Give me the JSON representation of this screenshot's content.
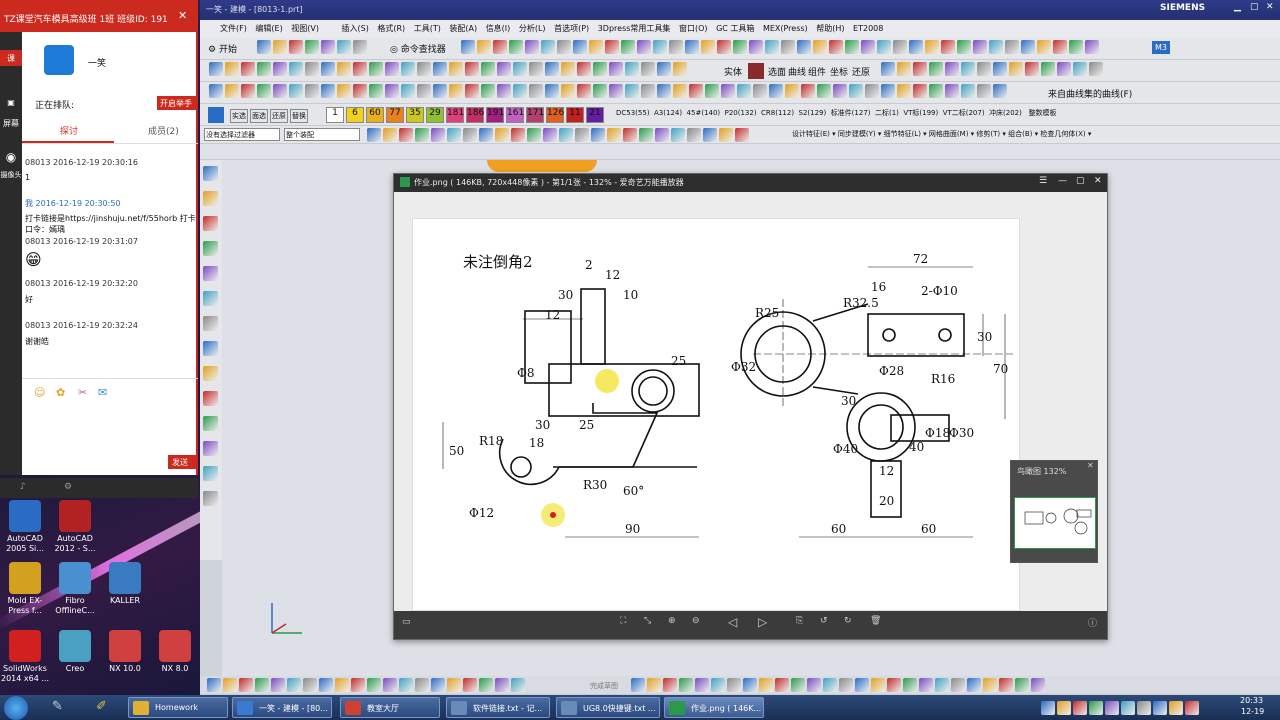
{
  "chat": {
    "title": "TZ课堂汽车模具高级班 1班  班级ID: 191",
    "tab_left": "课",
    "screen_label": "屏幕",
    "camera_label": "摄像头",
    "avatar_text": "一笑",
    "queue_label": "正在排队:",
    "raise_hand": "开启举手",
    "tabs": [
      "探讨",
      "成员(2)"
    ],
    "messages": [
      {
        "name": "08013 2016-12-19 20:30:16",
        "text": "1"
      },
      {
        "name": "我 2016-12-19 20:30:50",
        "text": "打卡链接是https://jinshuju.net/f/55horb  打卡口令：嫣瑀"
      },
      {
        "name": "08013 2016-12-19 20:31:07",
        "text": "😁"
      },
      {
        "name": "08013 2016-12-19 20:32:20",
        "text": "好"
      },
      {
        "name": "08013 2016-12-19 20:32:24",
        "text": "谢谢皓"
      }
    ],
    "send": "发送"
  },
  "desktop_icons": [
    {
      "label": "AutoCAD 2005 Si...",
      "color": "#2a6cc4"
    },
    {
      "label": "AutoCAD 2012 - S...",
      "color": "#b22222"
    },
    {
      "label": "Mold EX-Press f...",
      "color": "#d4a020"
    },
    {
      "label": "Fibro OfflineC...",
      "color": "#4a8fd0"
    },
    {
      "label": "KALLER",
      "color": "#3a7ac0"
    },
    {
      "label": "SolidWorks 2014 x64 ...",
      "color": "#d02020"
    },
    {
      "label": "Creo",
      "color": "#4aa0c0"
    },
    {
      "label": "NX 10.0",
      "color": "#d04040"
    },
    {
      "label": "NX 8.0",
      "color": "#d04040"
    }
  ],
  "nx": {
    "title": "一笑 - 建模 - [8013-1.prt]",
    "brand": "SIEMENS",
    "menu": [
      "文件(F)",
      "编辑(E)",
      "视图(V)",
      "插入(S)",
      "格式(R)",
      "工具(T)",
      "装配(A)",
      "信息(I)",
      "分析(L)",
      "首选项(P)",
      "3Dpress常用工具集",
      "窗口(O)",
      "GC 工具箱",
      "MEX(Press)",
      "帮助(H)",
      "ET2008"
    ],
    "start": "开始",
    "cmd_finder": "命令查找器",
    "m3": "M3",
    "row2_labels": [
      "实体",
      "选面",
      "曲线",
      "组件",
      "坐标",
      "还原"
    ],
    "row3_label": "来自曲线集的曲线(F)",
    "row4_labels": [
      "实选",
      "面选",
      "还原",
      "替换",
      "DC53(55)",
      "A3(124)",
      "45#(140)",
      "P20(132)",
      "CR8(112)",
      "S2(129)",
      "标准件(127)",
      "二标(1)",
      "VT标(199)",
      "VT二标(207)",
      "冲床(202)",
      "整数模板"
    ],
    "num_boxes": [
      "1",
      "6",
      "60",
      "77",
      "35",
      "29",
      "181",
      "186",
      "191",
      "161",
      "171",
      "126",
      "11",
      "21"
    ],
    "filter": "没有选择过滤器",
    "assembly": "整个装配",
    "row5_labels": [
      "设计特征(E)",
      "同步建模(Y)",
      "细节特征(L)",
      "网格曲面(M)",
      "修剪(T)",
      "组合(B)",
      "检查几何体(X)"
    ],
    "bottom_label": "完成草图"
  },
  "viewer": {
    "title": "作业.png ( 146KB, 720x448像素 ) - 第1/1张 - 132% - 爱奇艺万能播放器",
    "drawing_title": "未注倒角2",
    "dims_left": [
      "2",
      "12",
      "30",
      "10",
      "12",
      "Φ8",
      "25",
      "30",
      "25",
      "50",
      "R18",
      "18",
      "R30",
      "60°",
      "Φ12",
      "90"
    ],
    "dims_right": [
      "72",
      "16",
      "R32.5",
      "2-Φ10",
      "R25",
      "30",
      "Φ32",
      "Φ28",
      "R16",
      "70",
      "Φ18",
      "Φ30",
      "Φ40",
      "40",
      "12",
      "20",
      "60",
      "60",
      "30"
    ],
    "thumb_label": "鸟瞰图  132%"
  },
  "taskbar": {
    "items": [
      {
        "label": "Homework",
        "color": "#e0b030"
      },
      {
        "label": "一笑 - 建模 - [80...",
        "color": "#3a7ad0"
      },
      {
        "label": "教室大厅",
        "color": "#d04030"
      },
      {
        "label": "软件链接.txt - 记...",
        "color": "#6a8ab8"
      },
      {
        "label": "UG8.0快捷键.txt ...",
        "color": "#6a8ab8"
      },
      {
        "label": "作业.png ( 146K...",
        "color": "#2a9a4a"
      }
    ],
    "time": "20:33",
    "date": "12-19"
  }
}
